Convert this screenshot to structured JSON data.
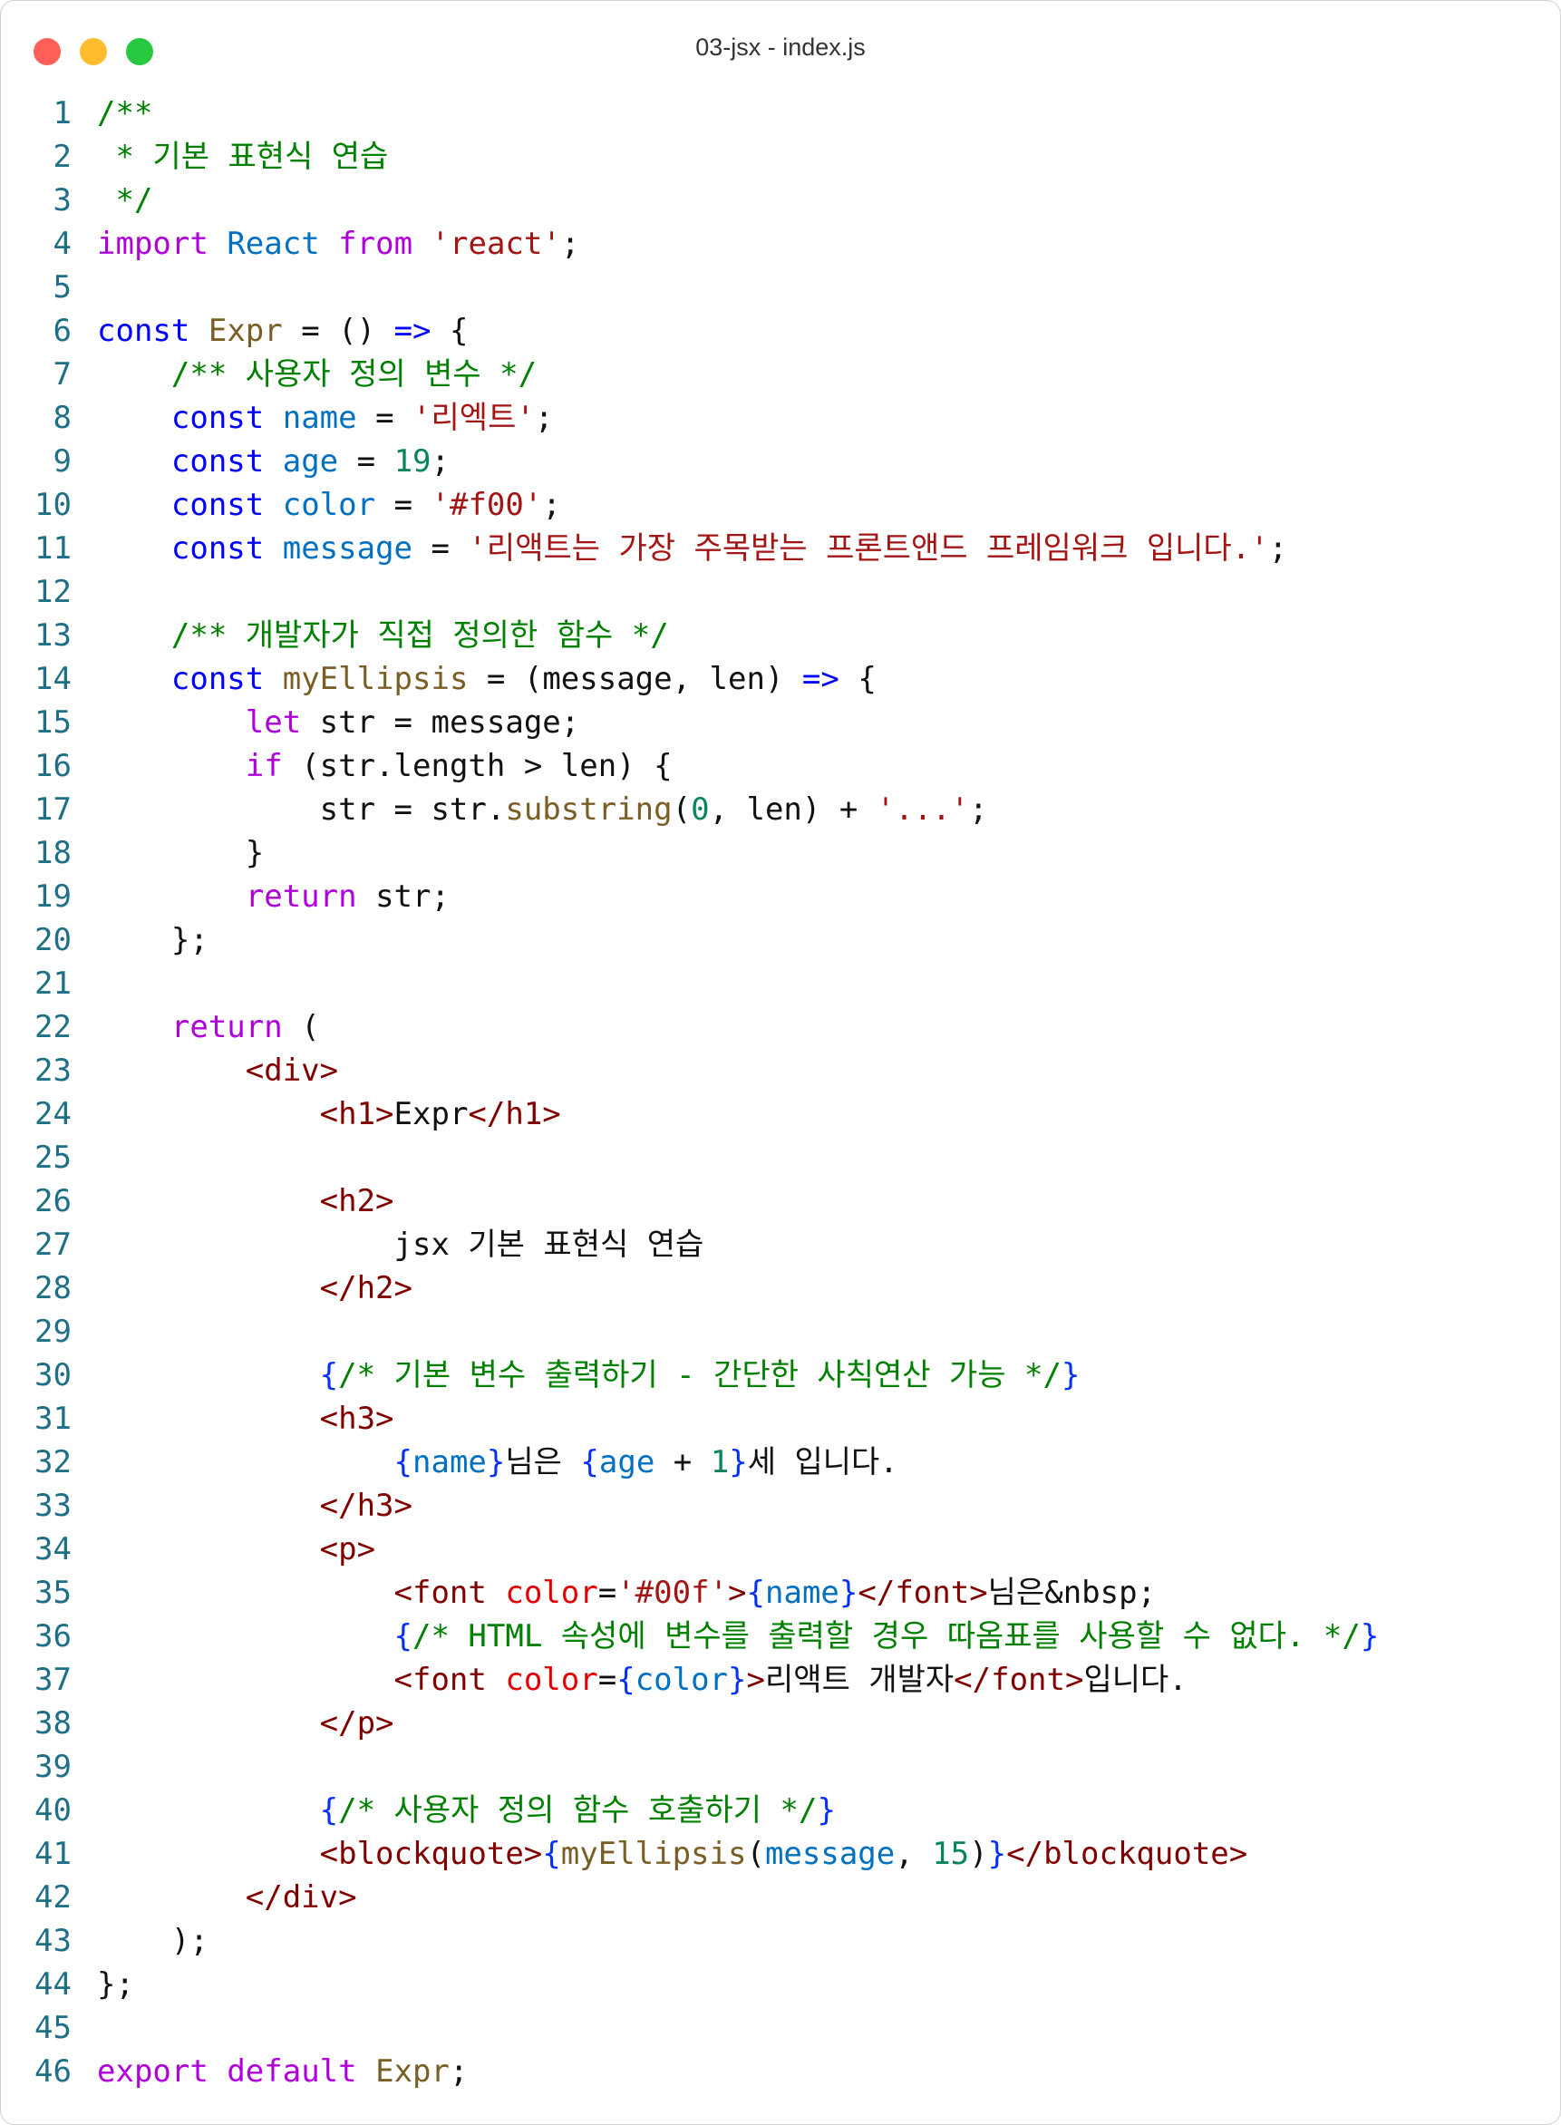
{
  "window": {
    "title": "03-jsx - index.js",
    "controls": [
      {
        "name": "close",
        "color": "#ff5f57"
      },
      {
        "name": "minimize",
        "color": "#febc2e"
      },
      {
        "name": "zoom",
        "color": "#28c840"
      }
    ]
  },
  "editor": {
    "lines": [
      [
        [
          "c",
          "/**"
        ]
      ],
      [
        [
          "c",
          " * 기본 표현식 연습"
        ]
      ],
      [
        [
          "c",
          " */"
        ]
      ],
      [
        [
          "k",
          "import"
        ],
        [
          "p",
          " "
        ],
        [
          "v",
          "React"
        ],
        [
          "p",
          " "
        ],
        [
          "k",
          "from"
        ],
        [
          "p",
          " "
        ],
        [
          "s",
          "'react'"
        ],
        [
          "p",
          ";"
        ]
      ],
      [],
      [
        [
          "d",
          "const"
        ],
        [
          "p",
          " "
        ],
        [
          "f",
          "Expr"
        ],
        [
          "p",
          " = () "
        ],
        [
          "d",
          "=>"
        ],
        [
          "p",
          " {"
        ]
      ],
      [
        [
          "p",
          "    "
        ],
        [
          "c",
          "/** 사용자 정의 변수 */"
        ]
      ],
      [
        [
          "p",
          "    "
        ],
        [
          "d",
          "const"
        ],
        [
          "p",
          " "
        ],
        [
          "v",
          "name"
        ],
        [
          "p",
          " = "
        ],
        [
          "s",
          "'리엑트'"
        ],
        [
          "p",
          ";"
        ]
      ],
      [
        [
          "p",
          "    "
        ],
        [
          "d",
          "const"
        ],
        [
          "p",
          " "
        ],
        [
          "v",
          "age"
        ],
        [
          "p",
          " = "
        ],
        [
          "n",
          "19"
        ],
        [
          "p",
          ";"
        ]
      ],
      [
        [
          "p",
          "    "
        ],
        [
          "d",
          "const"
        ],
        [
          "p",
          " "
        ],
        [
          "v",
          "color"
        ],
        [
          "p",
          " = "
        ],
        [
          "s",
          "'#f00'"
        ],
        [
          "p",
          ";"
        ]
      ],
      [
        [
          "p",
          "    "
        ],
        [
          "d",
          "const"
        ],
        [
          "p",
          " "
        ],
        [
          "v",
          "message"
        ],
        [
          "p",
          " = "
        ],
        [
          "s",
          "'리액트는 가장 주목받는 프론트앤드 프레임워크 입니다.'"
        ],
        [
          "p",
          ";"
        ]
      ],
      [],
      [
        [
          "p",
          "    "
        ],
        [
          "c",
          "/** 개발자가 직접 정의한 함수 */"
        ]
      ],
      [
        [
          "p",
          "    "
        ],
        [
          "d",
          "const"
        ],
        [
          "p",
          " "
        ],
        [
          "f",
          "myEllipsis"
        ],
        [
          "p",
          " = ("
        ],
        [
          "p",
          "message, len"
        ],
        [
          "p",
          ") "
        ],
        [
          "d",
          "=>"
        ],
        [
          "p",
          " {"
        ]
      ],
      [
        [
          "p",
          "        "
        ],
        [
          "k",
          "let"
        ],
        [
          "p",
          " str = message;"
        ]
      ],
      [
        [
          "p",
          "        "
        ],
        [
          "k",
          "if"
        ],
        [
          "p",
          " (str.length > len) {"
        ]
      ],
      [
        [
          "p",
          "            str = str."
        ],
        [
          "f",
          "substring"
        ],
        [
          "p",
          "("
        ],
        [
          "n",
          "0"
        ],
        [
          "p",
          ", len) + "
        ],
        [
          "s",
          "'...'"
        ],
        [
          "p",
          ";"
        ]
      ],
      [
        [
          "p",
          "        }"
        ]
      ],
      [
        [
          "p",
          "        "
        ],
        [
          "k",
          "return"
        ],
        [
          "p",
          " str;"
        ]
      ],
      [
        [
          "p",
          "    };"
        ]
      ],
      [],
      [
        [
          "p",
          "    "
        ],
        [
          "k",
          "return"
        ],
        [
          "p",
          " ("
        ]
      ],
      [
        [
          "p",
          "        "
        ],
        [
          "t",
          "<div>"
        ]
      ],
      [
        [
          "p",
          "            "
        ],
        [
          "t",
          "<h1>"
        ],
        [
          "p",
          "Expr"
        ],
        [
          "t",
          "</h1>"
        ]
      ],
      [],
      [
        [
          "p",
          "            "
        ],
        [
          "t",
          "<h2>"
        ]
      ],
      [
        [
          "p",
          "                jsx 기본 표현식 연습"
        ]
      ],
      [
        [
          "p",
          "            "
        ],
        [
          "t",
          "</h2>"
        ]
      ],
      [],
      [
        [
          "p",
          "            "
        ],
        [
          "b",
          "{"
        ],
        [
          "c",
          "/* 기본 변수 출력하기 - 간단한 사칙연산 가능 */"
        ],
        [
          "b",
          "}"
        ]
      ],
      [
        [
          "p",
          "            "
        ],
        [
          "t",
          "<h3>"
        ]
      ],
      [
        [
          "p",
          "                "
        ],
        [
          "b",
          "{"
        ],
        [
          "v",
          "name"
        ],
        [
          "b",
          "}"
        ],
        [
          "p",
          "님은 "
        ],
        [
          "b",
          "{"
        ],
        [
          "v",
          "age"
        ],
        [
          "p",
          " + "
        ],
        [
          "n",
          "1"
        ],
        [
          "b",
          "}"
        ],
        [
          "p",
          "세 입니다."
        ]
      ],
      [
        [
          "p",
          "            "
        ],
        [
          "t",
          "</h3>"
        ]
      ],
      [
        [
          "p",
          "            "
        ],
        [
          "t",
          "<p>"
        ]
      ],
      [
        [
          "p",
          "                "
        ],
        [
          "t",
          "<font"
        ],
        [
          "p",
          " "
        ],
        [
          "a",
          "color"
        ],
        [
          "p",
          "="
        ],
        [
          "s",
          "'#00f'"
        ],
        [
          "t",
          ">"
        ],
        [
          "b",
          "{"
        ],
        [
          "v",
          "name"
        ],
        [
          "b",
          "}"
        ],
        [
          "t",
          "</font>"
        ],
        [
          "p",
          "님은&nbsp;"
        ]
      ],
      [
        [
          "p",
          "                "
        ],
        [
          "b",
          "{"
        ],
        [
          "c",
          "/* HTML 속성에 변수를 출력할 경우 따옴표를 사용할 수 없다. */"
        ],
        [
          "b",
          "}"
        ]
      ],
      [
        [
          "p",
          "                "
        ],
        [
          "t",
          "<font"
        ],
        [
          "p",
          " "
        ],
        [
          "a",
          "color"
        ],
        [
          "p",
          "="
        ],
        [
          "b",
          "{"
        ],
        [
          "v",
          "color"
        ],
        [
          "b",
          "}"
        ],
        [
          "t",
          ">"
        ],
        [
          "p",
          "리액트 개발자"
        ],
        [
          "t",
          "</font>"
        ],
        [
          "p",
          "입니다."
        ]
      ],
      [
        [
          "p",
          "            "
        ],
        [
          "t",
          "</p>"
        ]
      ],
      [],
      [
        [
          "p",
          "            "
        ],
        [
          "b",
          "{"
        ],
        [
          "c",
          "/* 사용자 정의 함수 호출하기 */"
        ],
        [
          "b",
          "}"
        ]
      ],
      [
        [
          "p",
          "            "
        ],
        [
          "t",
          "<blockquote>"
        ],
        [
          "b",
          "{"
        ],
        [
          "f",
          "myEllipsis"
        ],
        [
          "p",
          "("
        ],
        [
          "v",
          "message"
        ],
        [
          "p",
          ", "
        ],
        [
          "n",
          "15"
        ],
        [
          "p",
          ")"
        ],
        [
          "b",
          "}"
        ],
        [
          "t",
          "</blockquote>"
        ]
      ],
      [
        [
          "p",
          "        "
        ],
        [
          "t",
          "</div>"
        ]
      ],
      [
        [
          "p",
          "    );"
        ]
      ],
      [
        [
          "p",
          "};"
        ]
      ],
      [],
      [
        [
          "k",
          "export"
        ],
        [
          "p",
          " "
        ],
        [
          "k",
          "default"
        ],
        [
          "p",
          " "
        ],
        [
          "f",
          "Expr"
        ],
        [
          "p",
          ";"
        ]
      ]
    ]
  }
}
